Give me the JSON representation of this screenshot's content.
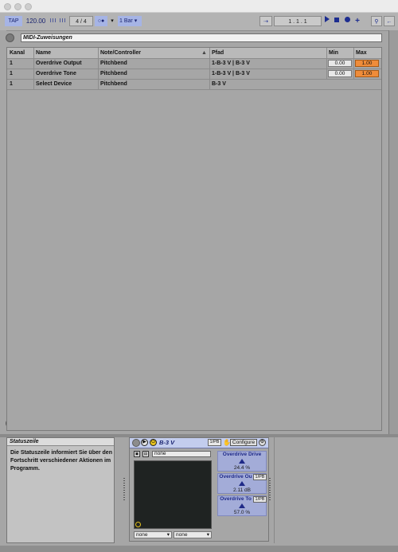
{
  "colors": {
    "accent_blue": "#a6b4e5",
    "max_orange": "#ef8c3a",
    "xy_pad": "#1f2322",
    "panel_bg": "#a6a6a6"
  },
  "transport": {
    "tap": "TAP",
    "tempo": "120.00",
    "signature_num": "4",
    "signature_sep": "/",
    "signature_den": "4",
    "metronome_icon": "metronome-icon",
    "quantize": "1 Bar",
    "position": "1 .   1 .   1"
  },
  "midi_panel": {
    "title": "MIDI-Zuweisungen",
    "columns": [
      "Kanal",
      "Name",
      "Note/Controller",
      "Pfad",
      "Min",
      "Max"
    ],
    "rows": [
      {
        "kanal": "1",
        "name": "Overdrive Output",
        "controller": "Pitchbend",
        "pfad": "1-B-3 V | B-3 V",
        "min": "0.00",
        "max": "1.00"
      },
      {
        "kanal": "1",
        "name": "Overdrive Tone",
        "controller": "Pitchbend",
        "pfad": "1-B-3 V | B-3 V",
        "min": "0.00",
        "max": "1.00"
      },
      {
        "kanal": "1",
        "name": "Select Device",
        "controller": "Pitchbend",
        "pfad": "B-3 V",
        "min": "",
        "max": ""
      }
    ]
  },
  "info": {
    "title": "Statuszeile",
    "text": "Die Statuszeile informiert Sie über den Fortschritt verschiedener Aktionen im Programm."
  },
  "device": {
    "name": "B-3 V",
    "midi_tag": "1/PB",
    "configure": "Configure",
    "preset": "none",
    "select_a": "none",
    "select_b": "none",
    "params": [
      {
        "name": "Overdrive Drive",
        "value": "24.4 %",
        "tag": ""
      },
      {
        "name": "Overdrive Ou",
        "value": "2.11 dB",
        "tag": "1/PB"
      },
      {
        "name": "Overdrive To",
        "value": "57.0 %",
        "tag": "1/PB"
      }
    ]
  }
}
